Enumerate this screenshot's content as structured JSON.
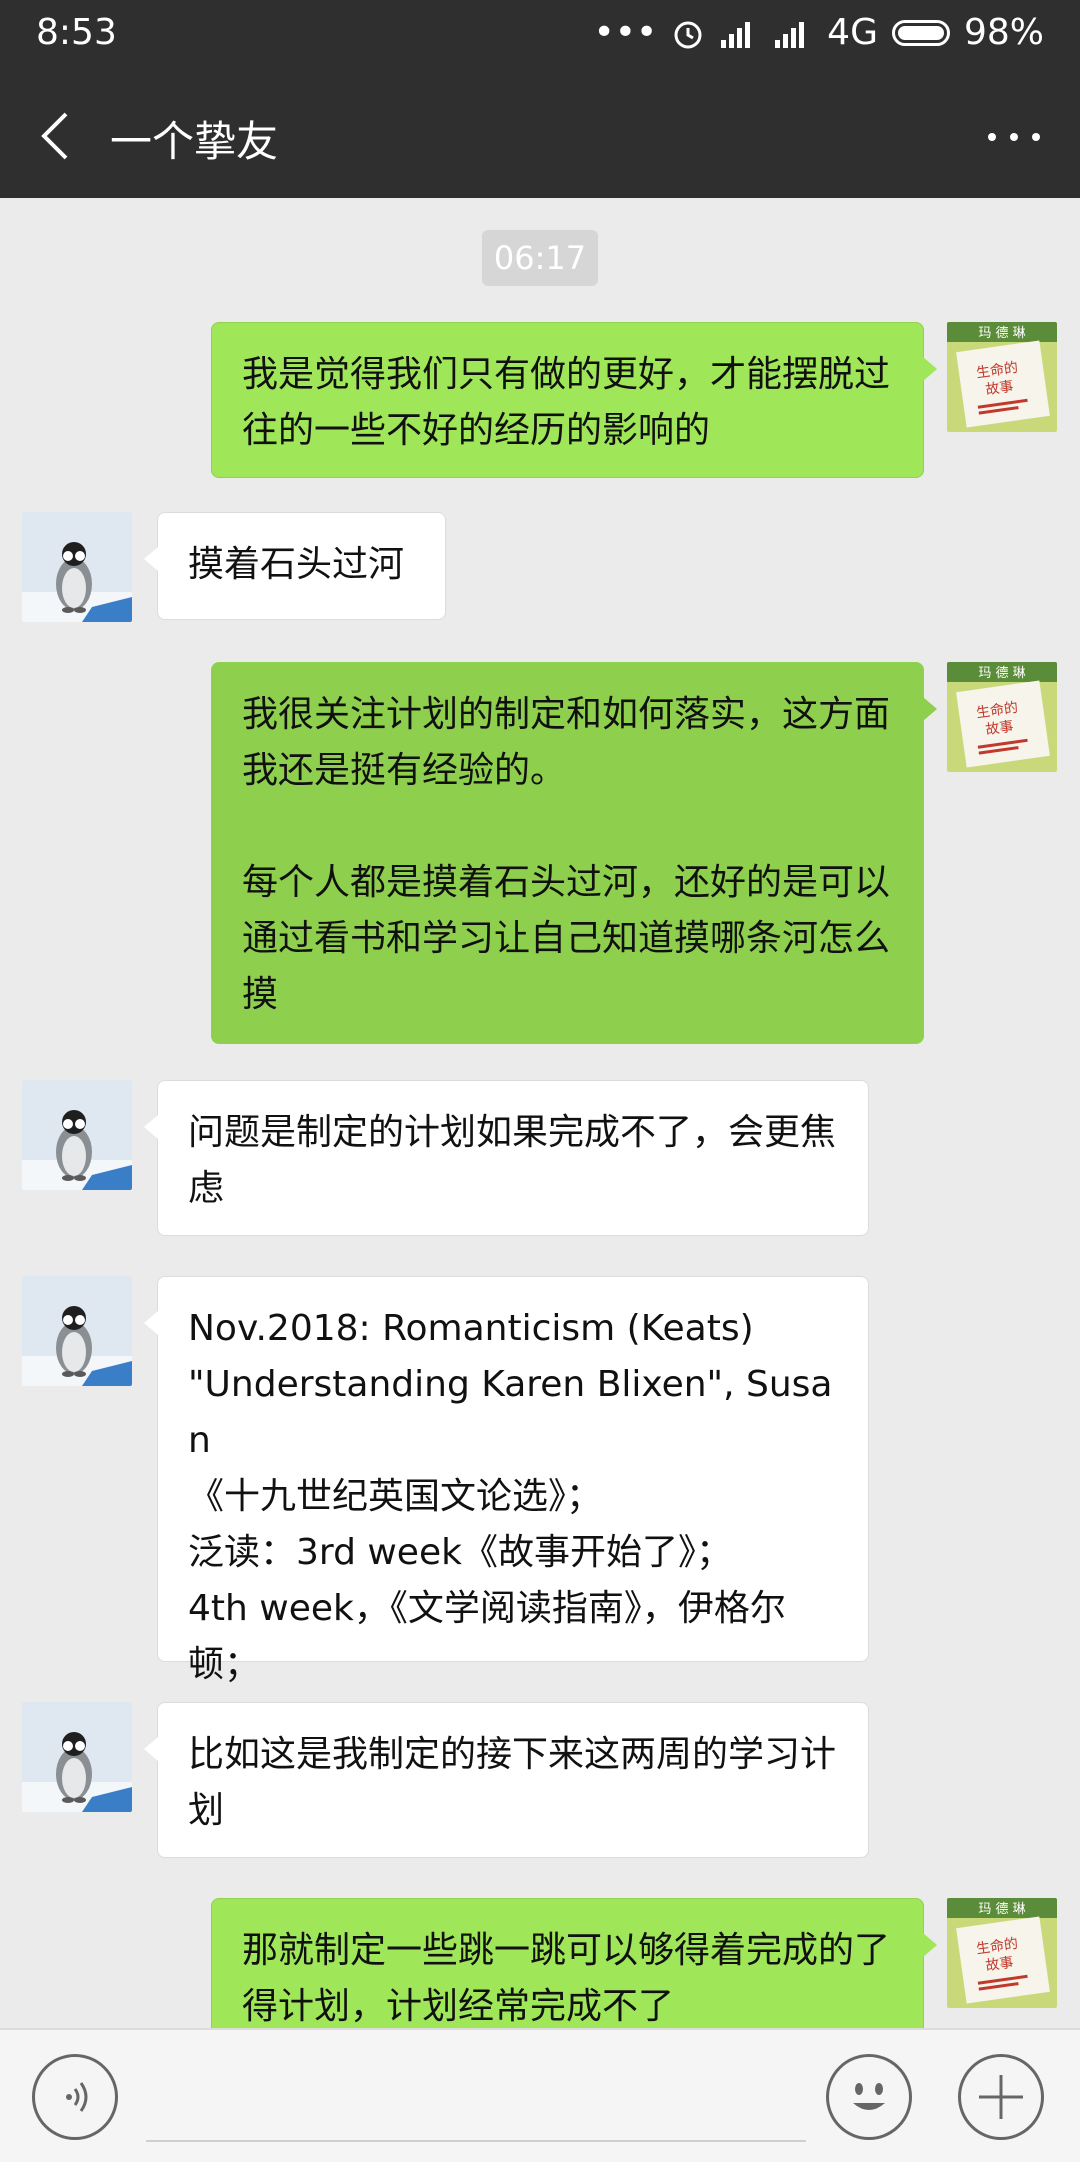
{
  "status_bar": {
    "time": "8:53",
    "network": "4G",
    "battery": "98%",
    "icons": [
      "more-dots-icon",
      "alarm-icon",
      "signal-icon",
      "signal-icon",
      "battery-icon"
    ]
  },
  "header": {
    "title": "一个挚友",
    "back_icon": "chevron-left-icon",
    "more_icon": "more-horizontal-icon"
  },
  "chat": {
    "timestamp": "06:17",
    "messages": [
      {
        "from": "me",
        "text": "我是觉得我们只有做的更好，才能摆脱过往的一些不好的经历的影响的"
      },
      {
        "from": "them",
        "text": "摸着石头过河"
      },
      {
        "from": "me",
        "text": "我很关注计划的制定和如何落实，这方面我还是挺有经验的。\n\n每个人都是摸着石头过河，还好的是可以通过看书和学习让自己知道摸哪条河怎么摸"
      },
      {
        "from": "them",
        "text": "问题是制定的计划如果完成不了，会更焦虑"
      },
      {
        "from": "them",
        "text": "Nov.2018: Romanticism (Keats)\n\"Understanding Karen Blixen\", Susan\n《十九世纪英国文论选》；\n泛读：3rd week《故事开始了》；\n4th week，《文学阅读指南》，伊格尔顿；"
      },
      {
        "from": "them",
        "text": "比如这是我制定的接下来这两周的学习计划"
      },
      {
        "from": "me",
        "text": "那就制定一些跳一跳可以够得着完成的了得计划，计划经常完成不了"
      }
    ],
    "my_avatar": {
      "title_text": "生命的故事",
      "header_text": "玛 德 琳"
    }
  },
  "input_bar": {
    "voice_icon": "voice-icon",
    "emoji_icon": "emoji-icon",
    "plus_icon": "plus-icon"
  },
  "colors": {
    "bar_bg": "#2f2f2f",
    "chat_bg": "#ebebeb",
    "my_bubble": "#9fe658",
    "their_bubble": "#ffffff"
  }
}
